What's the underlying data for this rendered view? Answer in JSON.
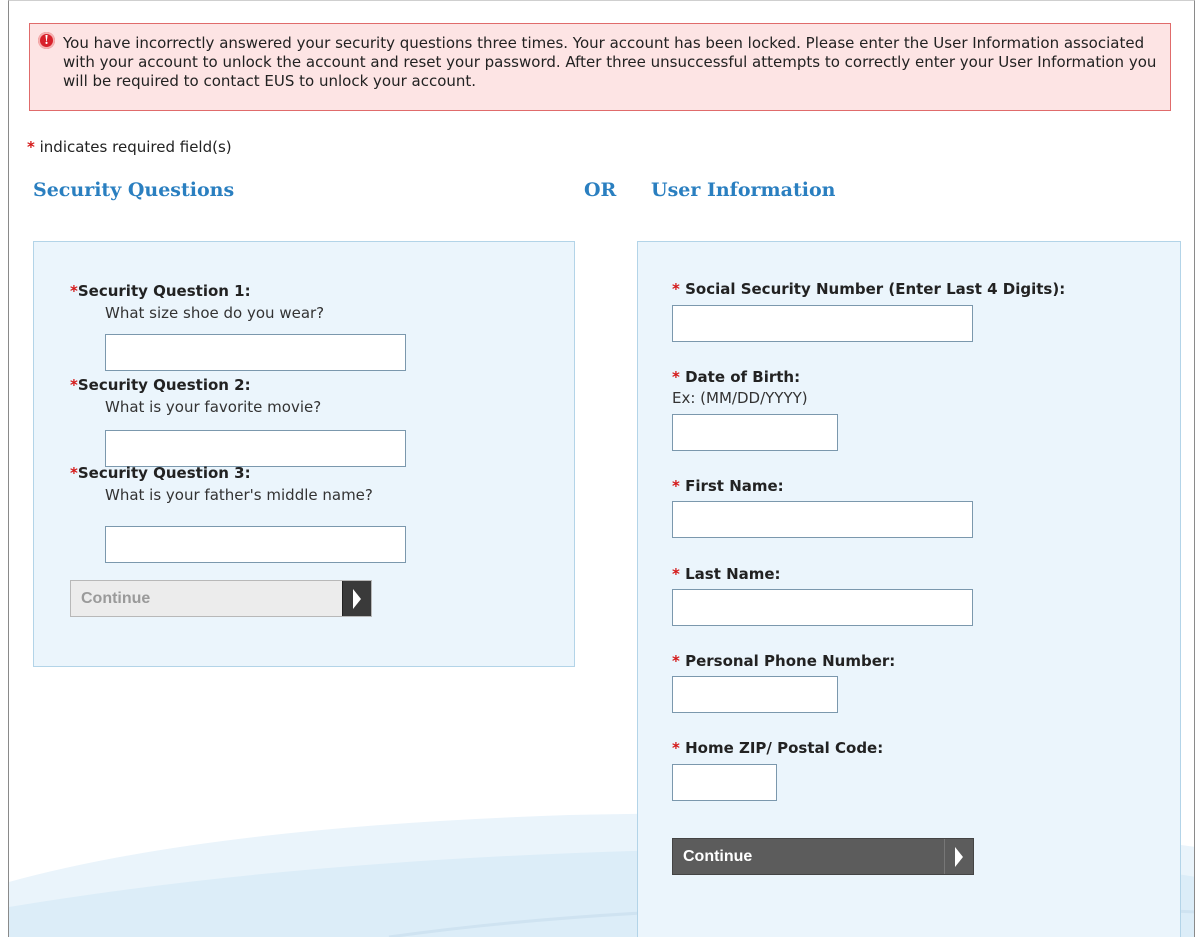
{
  "alert": {
    "icon": "error-info-icon",
    "message": "You have incorrectly answered your security questions three times. Your account has been locked. Please enter the User Information associated with your account to unlock the account and reset your password. After three unsuccessful attempts to correctly enter your User Information you will be required to contact EUS to unlock your account."
  },
  "required_note": {
    "star": "*",
    "text": " indicates required field(s)"
  },
  "sections": {
    "security_title": "Security Questions",
    "or_label": "OR",
    "user_info_title": "User Information"
  },
  "security_questions": {
    "q1": {
      "star": "*",
      "label": "Security Question 1:",
      "question": "What size shoe do you wear?",
      "value": ""
    },
    "q2": {
      "star": "*",
      "label": "Security Question 2:",
      "question": "What is your favorite movie?",
      "value": ""
    },
    "q3": {
      "star": "*",
      "label": "Security Question 3:",
      "question": "What is your father's middle name?",
      "value": ""
    },
    "continue_label": "Continue"
  },
  "user_info": {
    "ssn": {
      "star": "*",
      "label": " Social Security Number (Enter Last 4 Digits):",
      "value": ""
    },
    "dob": {
      "star": "*",
      "label": " Date of Birth:",
      "hint": "Ex: (MM/DD/YYYY)",
      "value": ""
    },
    "first_name": {
      "star": "*",
      "label": " First Name:",
      "value": ""
    },
    "last_name": {
      "star": "*",
      "label": " Last Name:",
      "value": ""
    },
    "phone": {
      "star": "*",
      "label": " Personal Phone Number:",
      "value": ""
    },
    "zip": {
      "star": "*",
      "label": " Home ZIP/ Postal Code:",
      "value": ""
    },
    "continue_label": "Continue"
  },
  "colors": {
    "alert_bg": "#fde4e4",
    "alert_border": "#e06b6b",
    "heading_blue": "#2a7fc0",
    "panel_bg": "#ebf5fc",
    "required_red": "#d41818"
  }
}
